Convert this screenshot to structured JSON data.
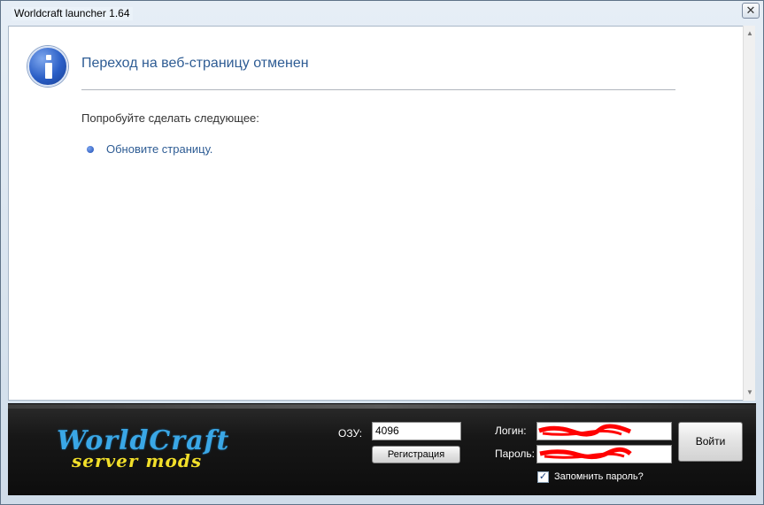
{
  "window": {
    "title": "Worldcraft launcher 1.64",
    "close_label": "✕"
  },
  "page": {
    "heading": "Переход на веб-страницу отменен",
    "subtext": "Попробуйте сделать следующее:",
    "link": "Обновите страницу."
  },
  "scrollbar": {
    "up": "▲",
    "down": "▼"
  },
  "launcher": {
    "logo_line1": "WorldCraft",
    "logo_line2": "server mods",
    "ram_label": "ОЗУ:",
    "ram_value": "4096",
    "register_label": "Регистрация",
    "login_label": "Логин:",
    "password_label": "Пароль:",
    "login_button": "Войти",
    "remember_label": "Запомнить пароль?",
    "remember_checked": "✓"
  }
}
